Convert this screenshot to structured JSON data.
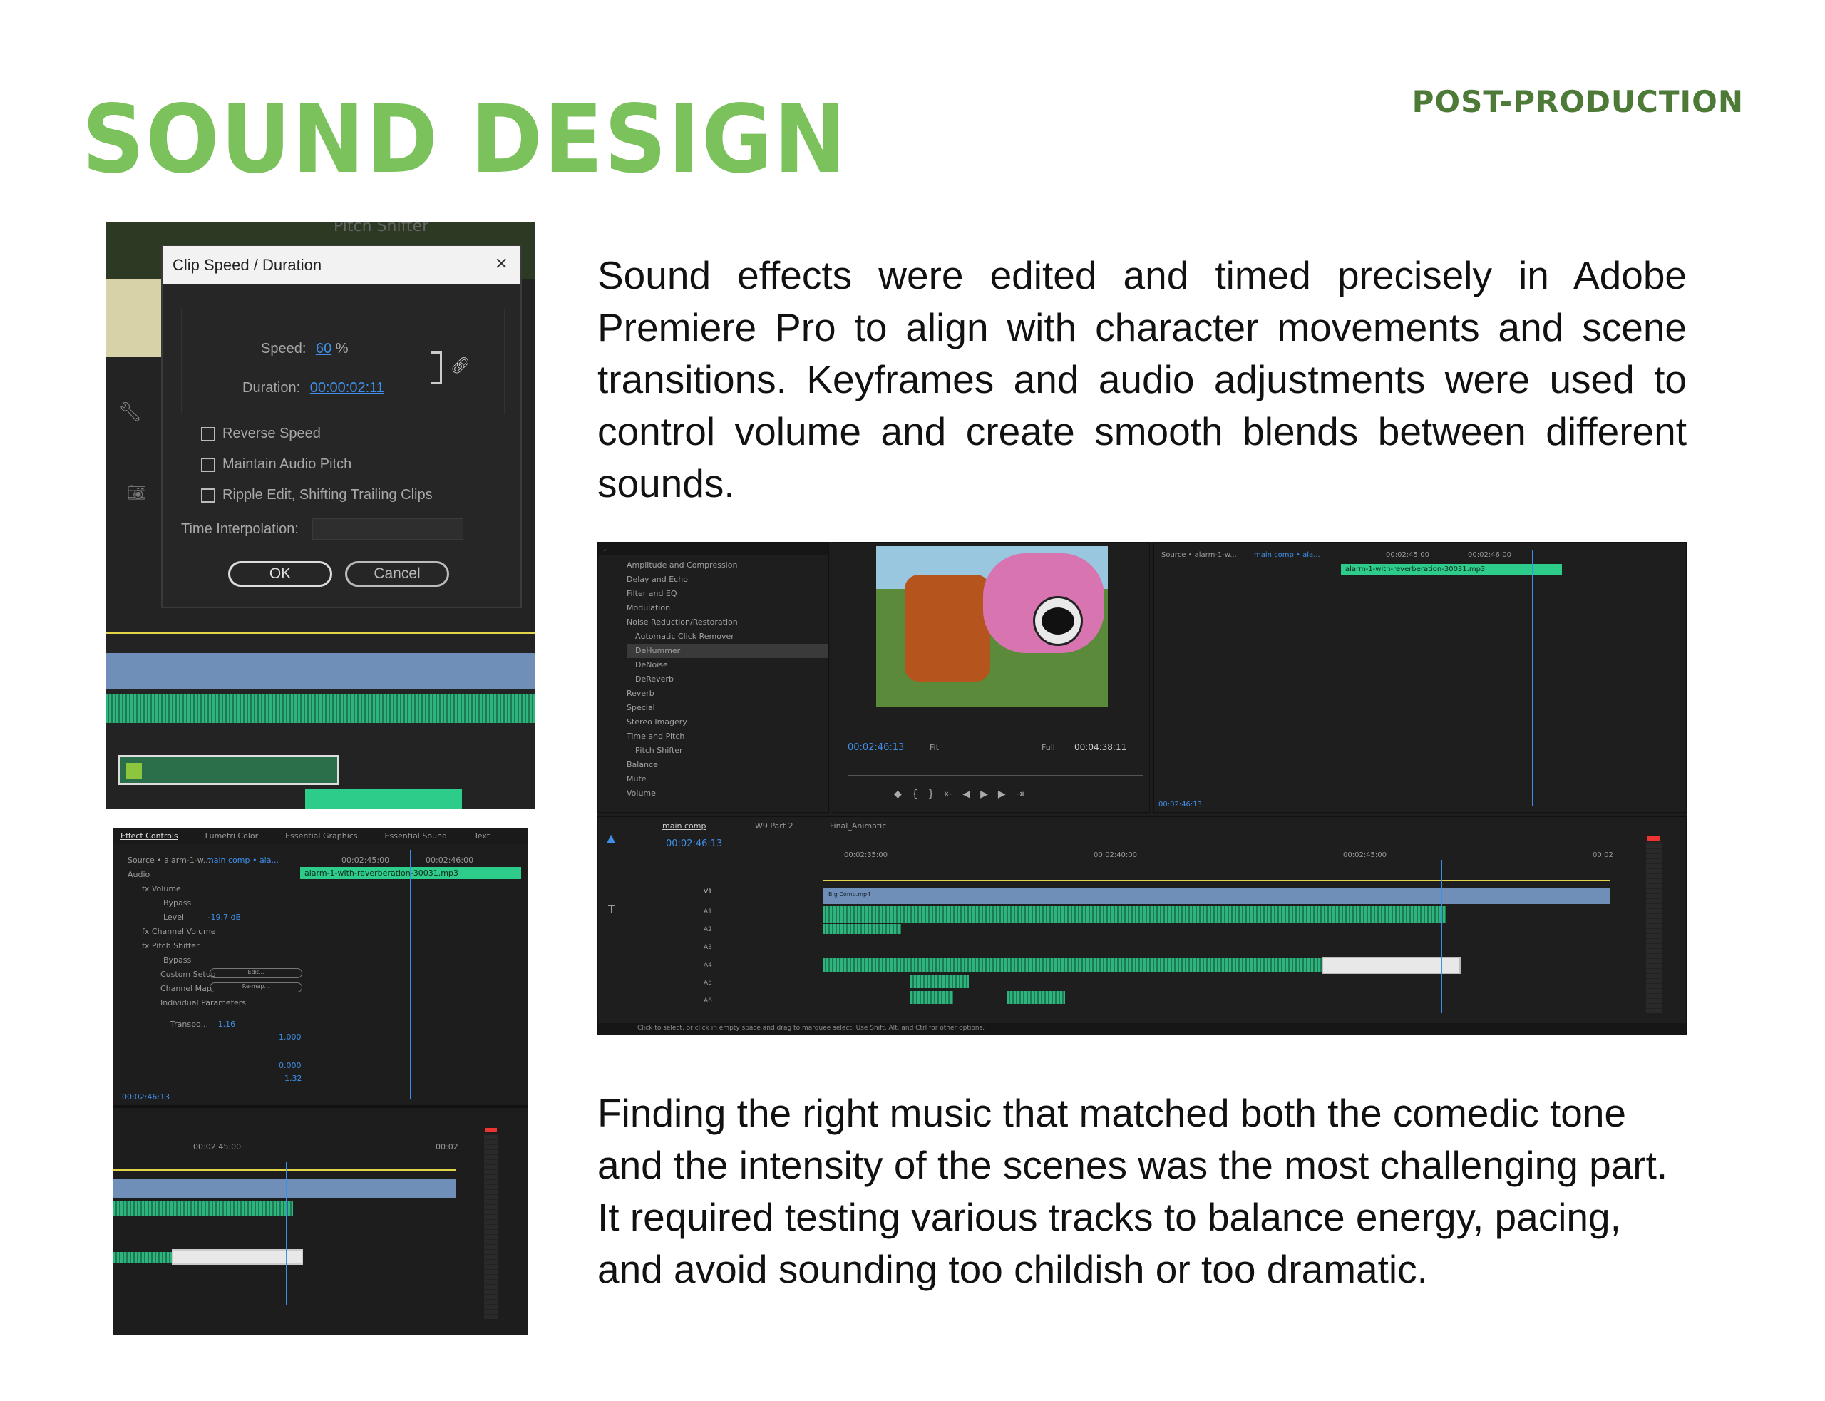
{
  "header": {
    "title": "SOUND DESIGN",
    "section": "POST-PRODUCTION"
  },
  "paragraphs": {
    "p1": "Sound effects were edited and timed precisely in Adobe Premiere Pro to align with character movements and scene transitions. Keyframes and audio adjustments were used to control volume and create smooth blends between different sounds.",
    "p2": "Finding the right music that matched both the comedic tone and the intensity of the scenes was the most challenging part. It required testing various tracks to balance energy, pacing, and avoid sounding too childish or too dramatic."
  },
  "clip_speed_dialog": {
    "bg_label": "Pitch Shifter",
    "title": "Clip Speed / Duration",
    "speed_label": "Speed:",
    "speed_value": "60",
    "speed_unit": "%",
    "duration_label": "Duration:",
    "duration_value": "00:00:02:11",
    "reverse_speed": "Reverse Speed",
    "maintain_pitch": "Maintain Audio Pitch",
    "ripple_edit": "Ripple Edit, Shifting Trailing Clips",
    "time_interpolation": "Time Interpolation:",
    "ok": "OK",
    "cancel": "Cancel"
  },
  "effect_controls": {
    "tabs": [
      "Effect Controls",
      "Lumetri Color",
      "Essential Graphics",
      "Essential Sound",
      "Text"
    ],
    "source": "Source • alarm-1-w...",
    "sequence": "main comp • ala...",
    "tc_a": "00:02:45:00",
    "tc_b": "00:02:46:00",
    "clip_name": "alarm-1-with-reverberation-30031.mp3",
    "audio": "Audio",
    "volume": "Volume",
    "bypass": "Bypass",
    "level": "Level",
    "level_value": "-19.7 dB",
    "channel_volume": "Channel Volume",
    "pitch_shifter": "Pitch Shifter",
    "custom_setup": "Custom Setup",
    "channel_map": "Channel Map",
    "edit": "Edit...",
    "remap": "Re-map...",
    "individual_parameters": "Individual Parameters",
    "transpose": "Transpo...",
    "transpose_value": "1.16",
    "val_top": "1.000",
    "val_mid": "0.000",
    "val_bot": "1.32",
    "timecode": "00:02:46:13",
    "tl_tc_a": "00:02:45:00",
    "tl_tc_b": "00:02"
  },
  "premiere": {
    "effects": [
      "Amplitude and Compression",
      "Delay and Echo",
      "Filter and EQ",
      "Modulation",
      "Noise Reduction/Restoration",
      "Automatic Click Remover",
      "DeHummer",
      "DeNoise",
      "DeReverb",
      "Reverb",
      "Special",
      "Stereo Imagery",
      "Time and Pitch",
      "Pitch Shifter",
      "Balance",
      "Mute",
      "Volume"
    ],
    "program_tc": "00:02:46:13",
    "fit": "Fit",
    "full": "Full",
    "duration_tc": "00:04:38:11",
    "source_label": "Source • alarm-1-w...",
    "seq_label": "main comp • ala...",
    "ec_tc_a": "00:02:45:00",
    "ec_tc_b": "00:02:46:00",
    "clip_name": "alarm-1-with-reverberation-30031.mp3",
    "ec_timecode": "00:02:46:13",
    "seq_tabs": [
      "main comp",
      "W9 Part 2",
      "Final_Animatic"
    ],
    "seq_tc": "00:02:46:13",
    "ruler": [
      "00:02:35:00",
      "00:02:40:00",
      "00:02:45:00",
      "00:02"
    ],
    "video_clip": "Big Comp.mp4",
    "tracks": [
      "V1",
      "A1",
      "A2",
      "A3",
      "A4",
      "A5",
      "A6"
    ],
    "status": "Click to select, or click in empty space and drag to marquee select. Use Shift, Alt, and Ctrl for other options."
  }
}
